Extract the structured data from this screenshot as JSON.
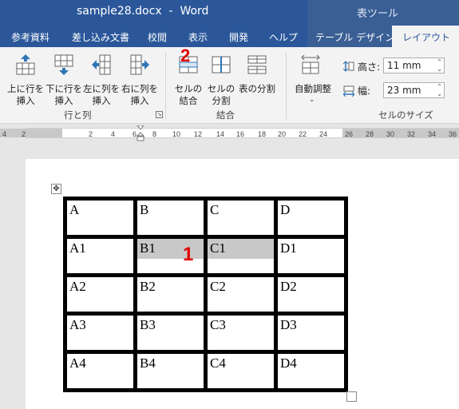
{
  "window": {
    "title": "sample28.docx  -  Word",
    "context_tab_header": "表ツール"
  },
  "tabs": [
    {
      "label": "参考資料"
    },
    {
      "label": "差し込み文書"
    },
    {
      "label": "校閲"
    },
    {
      "label": "表示"
    },
    {
      "label": "開発"
    },
    {
      "label": "ヘルプ"
    },
    {
      "label": "テーブル デザイン"
    },
    {
      "label": "レイアウト"
    }
  ],
  "active_tab": "レイアウト",
  "ribbon": {
    "groups": {
      "rows_cols": "行と列",
      "merge": "結合",
      "cell_size": "セルのサイズ"
    },
    "buttons": {
      "insert_above": "上に行を\n挿入",
      "insert_below": "下に行を\n挿入",
      "insert_left": "左に列を\n挿入",
      "insert_right": "右に列を\n挿入",
      "merge_cells": "セルの\n結合",
      "split_cells": "セルの\n分割",
      "split_table": "表の分割",
      "autofit": "自動調整"
    },
    "height_label": "高さ:",
    "height_value": "11 mm",
    "width_label": "幅:",
    "width_value": "23 mm"
  },
  "ruler": {
    "marks": [
      "4",
      "2",
      "2",
      "4",
      "6",
      "8",
      "10",
      "12",
      "14",
      "16",
      "18",
      "20",
      "22",
      "24",
      "26",
      "28",
      "30",
      "32",
      "34",
      "36"
    ]
  },
  "table": {
    "rows": [
      [
        "A",
        "B",
        "C",
        "D"
      ],
      [
        "A1",
        "B1",
        "C1",
        "D1"
      ],
      [
        "A2",
        "B2",
        "C2",
        "D2"
      ],
      [
        "A3",
        "B3",
        "C3",
        "D3"
      ],
      [
        "A4",
        "B4",
        "C4",
        "D4"
      ]
    ],
    "selected_cells": [
      "B1",
      "C1"
    ]
  },
  "annotations": {
    "step1": "1",
    "step2": "2",
    "color": "#e00000"
  },
  "colors": {
    "titlebar": "#2b579a",
    "context": "#3a5f95",
    "selection": "#c8c8c8"
  }
}
